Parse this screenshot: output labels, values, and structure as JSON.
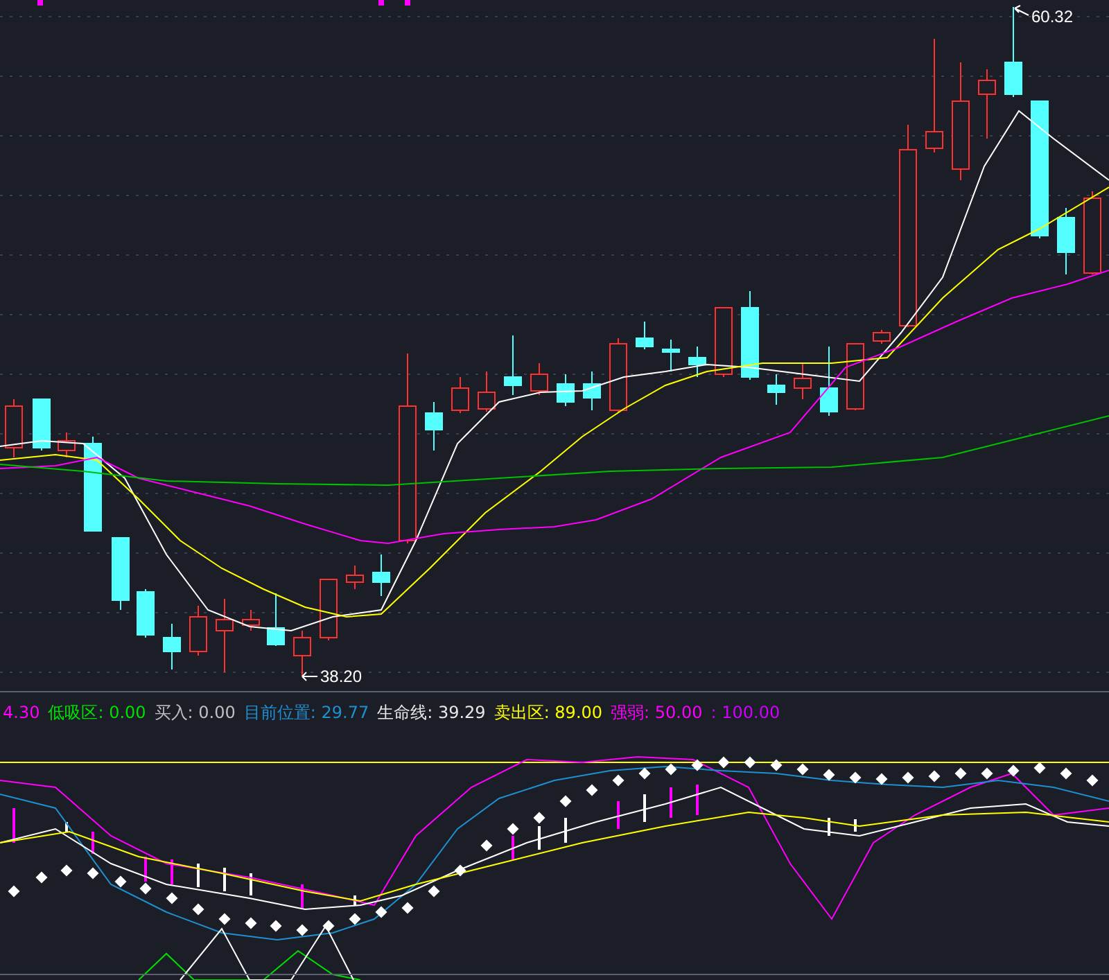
{
  "price_chart": {
    "high_label": "60.32",
    "low_label": "38.20"
  },
  "indicator_legend": [
    {
      "text": "4.30",
      "color": "#ff00ff"
    },
    {
      "text": "低吸区: 0.00",
      "color": "#00e000"
    },
    {
      "text": "买入: 0.00",
      "color": "#c0c0c0"
    },
    {
      "text": "目前位置: 29.77",
      "color": "#1e90d0"
    },
    {
      "text": "生命线: 39.29",
      "color": "#e8e8e8"
    },
    {
      "text": "卖出区: 89.00",
      "color": "#ffff00"
    },
    {
      "text": "强弱: 50.00",
      "color": "#ff00ff"
    },
    {
      "text": ": 100.00",
      "color": "#d000ff"
    }
  ]
}
